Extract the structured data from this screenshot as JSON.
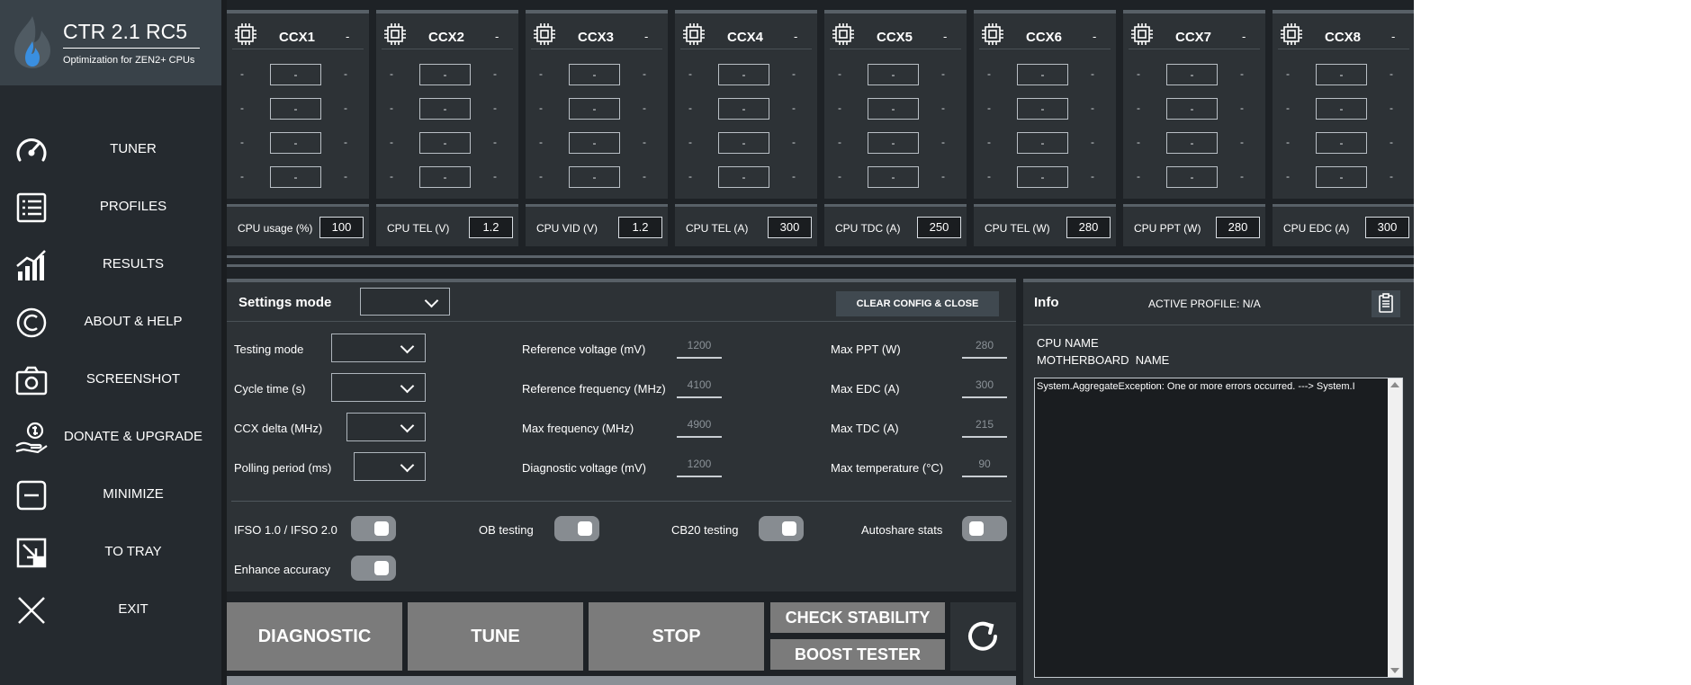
{
  "app": {
    "title": "CTR 2.1 RC5",
    "subtitle": "Optimization for ZEN2+ CPUs",
    "logo_icon": "flame-logo-icon"
  },
  "sidebar": {
    "items": [
      {
        "label": "TUNER",
        "icon": "speedometer-icon"
      },
      {
        "label": "PROFILES",
        "icon": "list-icon"
      },
      {
        "label": "RESULTS",
        "icon": "bar-chart-icon"
      },
      {
        "label": "ABOUT & HELP",
        "icon": "copyright-icon"
      },
      {
        "label": "SCREENSHOT",
        "icon": "camera-icon"
      },
      {
        "label": "DONATE & UPGRADE",
        "icon": "money-hand-icon"
      },
      {
        "label": "MINIMIZE",
        "icon": "minimize-icon"
      },
      {
        "label": "TO TRAY",
        "icon": "to-tray-icon"
      },
      {
        "label": "EXIT",
        "icon": "close-icon"
      }
    ]
  },
  "ccx": [
    {
      "name": "CCX1",
      "status": "-",
      "cores": [
        {
          "left": "-",
          "value": "-",
          "right": "-"
        },
        {
          "left": "-",
          "value": "-",
          "right": "-"
        },
        {
          "left": "-",
          "value": "-",
          "right": "-"
        },
        {
          "left": "-",
          "value": "-",
          "right": "-"
        }
      ]
    },
    {
      "name": "CCX2",
      "status": "-",
      "cores": [
        {
          "left": "-",
          "value": "-",
          "right": "-"
        },
        {
          "left": "-",
          "value": "-",
          "right": "-"
        },
        {
          "left": "-",
          "value": "-",
          "right": "-"
        },
        {
          "left": "-",
          "value": "-",
          "right": "-"
        }
      ]
    },
    {
      "name": "CCX3",
      "status": "-",
      "cores": [
        {
          "left": "-",
          "value": "-",
          "right": "-"
        },
        {
          "left": "-",
          "value": "-",
          "right": "-"
        },
        {
          "left": "-",
          "value": "-",
          "right": "-"
        },
        {
          "left": "-",
          "value": "-",
          "right": "-"
        }
      ]
    },
    {
      "name": "CCX4",
      "status": "-",
      "cores": [
        {
          "left": "-",
          "value": "-",
          "right": "-"
        },
        {
          "left": "-",
          "value": "-",
          "right": "-"
        },
        {
          "left": "-",
          "value": "-",
          "right": "-"
        },
        {
          "left": "-",
          "value": "-",
          "right": "-"
        }
      ]
    },
    {
      "name": "CCX5",
      "status": "-",
      "cores": [
        {
          "left": "-",
          "value": "-",
          "right": "-"
        },
        {
          "left": "-",
          "value": "-",
          "right": "-"
        },
        {
          "left": "-",
          "value": "-",
          "right": "-"
        },
        {
          "left": "-",
          "value": "-",
          "right": "-"
        }
      ]
    },
    {
      "name": "CCX6",
      "status": "-",
      "cores": [
        {
          "left": "-",
          "value": "-",
          "right": "-"
        },
        {
          "left": "-",
          "value": "-",
          "right": "-"
        },
        {
          "left": "-",
          "value": "-",
          "right": "-"
        },
        {
          "left": "-",
          "value": "-",
          "right": "-"
        }
      ]
    },
    {
      "name": "CCX7",
      "status": "-",
      "cores": [
        {
          "left": "-",
          "value": "-",
          "right": "-"
        },
        {
          "left": "-",
          "value": "-",
          "right": "-"
        },
        {
          "left": "-",
          "value": "-",
          "right": "-"
        },
        {
          "left": "-",
          "value": "-",
          "right": "-"
        }
      ]
    },
    {
      "name": "CCX8",
      "status": "-",
      "cores": [
        {
          "left": "-",
          "value": "-",
          "right": "-"
        },
        {
          "left": "-",
          "value": "-",
          "right": "-"
        },
        {
          "left": "-",
          "value": "-",
          "right": "-"
        },
        {
          "left": "-",
          "value": "-",
          "right": "-"
        }
      ]
    }
  ],
  "metrics": [
    {
      "label": "CPU usage (%)",
      "value": "100"
    },
    {
      "label": "CPU TEL (V)",
      "value": "1.2"
    },
    {
      "label": "CPU VID (V)",
      "value": "1.2"
    },
    {
      "label": "CPU TEL (A)",
      "value": "300"
    },
    {
      "label": "CPU TDC (A)",
      "value": "250"
    },
    {
      "label": "CPU TEL (W)",
      "value": "280"
    },
    {
      "label": "CPU PPT (W)",
      "value": "280"
    },
    {
      "label": "CPU EDC (A)",
      "value": "300"
    }
  ],
  "settings": {
    "title": "Settings mode",
    "mode_value": "",
    "clear_label": "CLEAR CONFIG & CLOSE",
    "dropdowns": [
      {
        "label": "Testing mode",
        "value": ""
      },
      {
        "label": "Cycle time (s)",
        "value": ""
      },
      {
        "label": "CCX delta (MHz)",
        "value": ""
      },
      {
        "label": "Polling period (ms)",
        "value": ""
      }
    ],
    "voltage_fields": [
      {
        "label": "Reference voltage (mV)",
        "value": "1200"
      },
      {
        "label": "Reference frequency (MHz)",
        "value": "4100"
      },
      {
        "label": "Max frequency (MHz)",
        "value": "4900"
      },
      {
        "label": "Diagnostic voltage (mV)",
        "value": "1200"
      }
    ],
    "limit_fields": [
      {
        "label": "Max PPT (W)",
        "value": "280"
      },
      {
        "label": "Max EDC (A)",
        "value": "300"
      },
      {
        "label": "Max TDC (A)",
        "value": "215"
      },
      {
        "label": "Max temperature (°C)",
        "value": "90"
      }
    ],
    "toggles": [
      {
        "label": "IFSO 1.0 / IFSO 2.0",
        "on": true
      },
      {
        "label": "OB testing",
        "on": true
      },
      {
        "label": "CB20 testing",
        "on": true
      },
      {
        "label": "Autoshare stats",
        "on": false
      },
      {
        "label": "Enhance accuracy",
        "on": true
      }
    ]
  },
  "actions": {
    "diagnostic": "DIAGNOSTIC",
    "tune": "TUNE",
    "stop": "STOP",
    "check_stability": "CHECK STABILITY",
    "boost_tester": "BOOST TESTER",
    "refresh_icon": "refresh-icon"
  },
  "info": {
    "title": "Info",
    "active_profile": "ACTIVE PROFILE: N/A",
    "cpu_name": "CPU NAME",
    "motherboard_name": "MOTHERBOARD  NAME",
    "log": "System.AggregateException: One or more errors occurred. ---> System.I",
    "copy_icon": "clipboard-icon"
  },
  "colors": {
    "background": "#1e2226",
    "panel": "#2d3236",
    "sidebar": "#252a2f",
    "brand": "#394249",
    "button": "#7b7b7b",
    "accent_border": "#586067"
  }
}
